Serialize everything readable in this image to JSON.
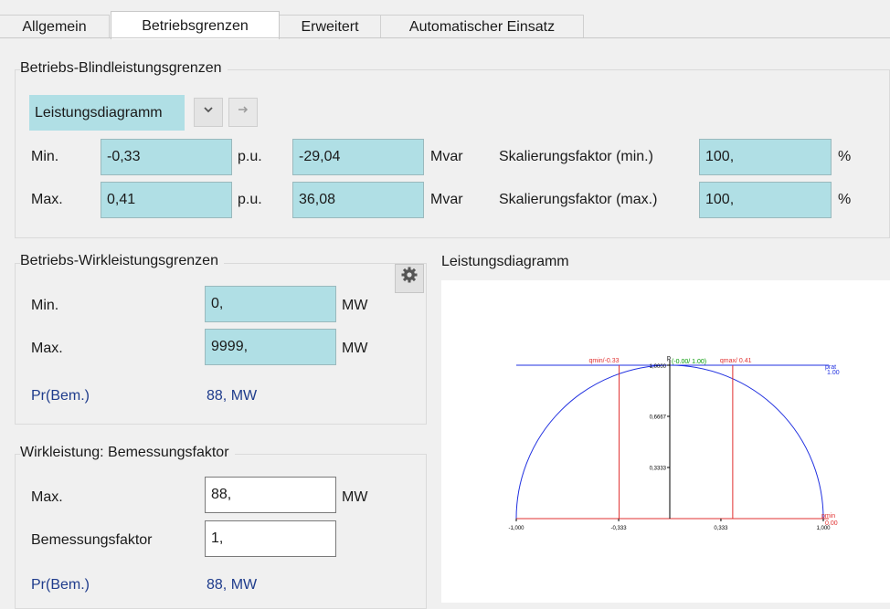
{
  "tabs": [
    {
      "label": "Allgemein"
    },
    {
      "label": "Betriebsgrenzen"
    },
    {
      "label": "Erweitert"
    },
    {
      "label": "Automatischer Einsatz"
    }
  ],
  "active_tab": "Betriebsgrenzen",
  "reactive": {
    "title": "Betriebs-Blindleistungsgrenzen",
    "mode": "Leistungsdiagramm",
    "rows": [
      {
        "label": "Min.",
        "pu_value": "-0,33",
        "pu_unit": "p.u.",
        "mvar_value": "-29,04",
        "mvar_unit": "Mvar",
        "scale_label": "Skalierungsfaktor (min.)",
        "scale_value": "100,",
        "scale_unit": "%"
      },
      {
        "label": "Max.",
        "pu_value": "0,41",
        "pu_unit": "p.u.",
        "mvar_value": "36,08",
        "mvar_unit": "Mvar",
        "scale_label": "Skalierungsfaktor (max.)",
        "scale_value": "100,",
        "scale_unit": "%"
      }
    ]
  },
  "active_power": {
    "title": "Betriebs-Wirkleistungsgrenzen",
    "min_label": "Min.",
    "min_value": "0,",
    "min_unit": "MW",
    "max_label": "Max.",
    "max_value": "9999,",
    "max_unit": "MW",
    "rated_label": "Pr(Bem.)",
    "rated_value": "88, MW"
  },
  "rating": {
    "title": "Wirkleistung: Bemessungsfaktor",
    "max_label": "Max.",
    "max_value": "88,",
    "max_unit": "MW",
    "factor_label": "Bemessungsfaktor",
    "factor_value": "1,",
    "rated_label": "Pr(Bem.)",
    "rated_value": "88, MW"
  },
  "diagram": {
    "title": "Leistungsdiagramm",
    "x_ticks": [
      "-1,000",
      "-0,333",
      "0,333",
      "1,000"
    ],
    "y_ticks": [
      "1,0000",
      "0,6667",
      "0,3333"
    ],
    "p_label": "p",
    "qmin_label": "qmin/-0.33",
    "qmax_label": "qmax/ 0.41",
    "origin_label": "(-0.00/ 1.00)",
    "prat_label": "prat",
    "prat_value": "1.00",
    "pmin_label": "pmin",
    "pmin_value": "0.00",
    "colors": {
      "circle": "#2030e0",
      "limits": "#e03030",
      "axis": "#000000",
      "origin": "#009900"
    }
  },
  "chart_data": {
    "type": "line",
    "title": "Leistungsdiagramm",
    "xlim": [
      -1.0,
      1.0
    ],
    "ylim": [
      0.0,
      1.0
    ],
    "x_ticks": [
      -1.0,
      -0.333,
      0.333,
      1.0
    ],
    "y_ticks": [
      1.0,
      0.6667,
      0.3333
    ],
    "series": [
      {
        "name": "qmin",
        "x": [
          -0.33,
          -0.33
        ],
        "y": [
          0.0,
          1.0
        ]
      },
      {
        "name": "qmax",
        "x": [
          0.41,
          0.41
        ],
        "y": [
          0.0,
          1.0
        ]
      },
      {
        "name": "prat",
        "x": [
          -1.0,
          1.0
        ],
        "y": [
          1.0,
          1.0
        ]
      },
      {
        "name": "pmin",
        "x": [
          -1.0,
          1.0
        ],
        "y": [
          0.0,
          0.0
        ]
      }
    ],
    "grid": false
  }
}
